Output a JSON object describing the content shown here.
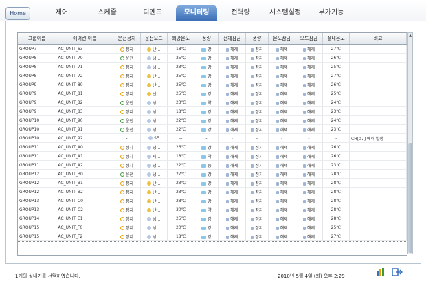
{
  "home_label": "Home",
  "tabs": [
    {
      "label": "제어"
    },
    {
      "label": "스케줄"
    },
    {
      "label": "디멘드"
    },
    {
      "label": "모니터링",
      "active": true
    },
    {
      "label": "전력량"
    },
    {
      "label": "시스템설정"
    },
    {
      "label": "부가기능"
    }
  ],
  "columns": [
    "그룹이름",
    "에어컨 이름",
    "운전정지",
    "운전모드",
    "희망온도",
    "풍량",
    "전체잠금",
    "풍량",
    "온도잠금",
    "모드잠금",
    "실내온도",
    "비고"
  ],
  "rows": [
    {
      "group": "GROUP7",
      "unit": "AC_UNIT_63",
      "op": "정지",
      "mode": "난...",
      "temp": "18℃",
      "fan": "강",
      "lock_all": "해제",
      "lock_fan": "정지",
      "lock_temp": "해제",
      "lock_mode": "해제",
      "room": "27℃",
      "note": ""
    },
    {
      "group": "GROUP8",
      "unit": "AC_UNIT_70",
      "op": "운전",
      "mode": "냉...",
      "temp": "25℃",
      "fan": "강",
      "lock_all": "해제",
      "lock_fan": "정지",
      "lock_temp": "해제",
      "lock_mode": "해제",
      "room": "26℃",
      "note": ""
    },
    {
      "group": "GROUP8",
      "unit": "AC_UNIT_71",
      "op": "정지",
      "mode": "냉...",
      "temp": "23℃",
      "fan": "강",
      "lock_all": "해제",
      "lock_fan": "정지",
      "lock_temp": "해제",
      "lock_mode": "해제",
      "room": "25℃",
      "note": ""
    },
    {
      "group": "GROUP8",
      "unit": "AC_UNIT_72",
      "op": "정지",
      "mode": "난...",
      "temp": "25℃",
      "fan": "강",
      "lock_all": "해제",
      "lock_fan": "정지",
      "lock_temp": "해제",
      "lock_mode": "해제",
      "room": "27℃",
      "note": ""
    },
    {
      "group": "GROUP9",
      "unit": "AC_UNIT_80",
      "op": "정지",
      "mode": "난...",
      "temp": "25℃",
      "fan": "강",
      "lock_all": "해제",
      "lock_fan": "정지",
      "lock_temp": "해제",
      "lock_mode": "해제",
      "room": "26℃",
      "note": ""
    },
    {
      "group": "GROUP9",
      "unit": "AC_UNIT_81",
      "op": "정지",
      "mode": "난...",
      "temp": "25℃",
      "fan": "강",
      "lock_all": "해제",
      "lock_fan": "정지",
      "lock_temp": "해제",
      "lock_mode": "해제",
      "room": "25℃",
      "note": ""
    },
    {
      "group": "GROUP9",
      "unit": "AC_UNIT_82",
      "op": "운전",
      "mode": "냉...",
      "temp": "23℃",
      "fan": "약",
      "lock_all": "해제",
      "lock_fan": "정지",
      "lock_temp": "해제",
      "lock_mode": "해제",
      "room": "24℃",
      "note": ""
    },
    {
      "group": "GROUP9",
      "unit": "AC_UNIT_83",
      "op": "정지",
      "mode": "냉...",
      "temp": "18℃",
      "fan": "강",
      "lock_all": "해제",
      "lock_fan": "정지",
      "lock_temp": "해제",
      "lock_mode": "해제",
      "room": "23℃",
      "note": ""
    },
    {
      "group": "GROUP10",
      "unit": "AC_UNIT_90",
      "op": "운전",
      "mode": "냉...",
      "temp": "22℃",
      "fan": "강",
      "lock_all": "해제",
      "lock_fan": "정지",
      "lock_temp": "해제",
      "lock_mode": "해제",
      "room": "24℃",
      "note": ""
    },
    {
      "group": "GROUP10",
      "unit": "AC_UNIT_91",
      "op": "운전",
      "mode": "냉...",
      "temp": "22℃",
      "fan": "강",
      "lock_all": "해제",
      "lock_fan": "정지",
      "lock_temp": "해제",
      "lock_mode": "해제",
      "room": "23℃",
      "note": ""
    },
    {
      "group": "GROUP10",
      "unit": "AC_UNIT_92",
      "op": "-",
      "mode": "SE",
      "temp": "--",
      "fan": "-",
      "lock_all": "-",
      "lock_fan": "-",
      "lock_temp": "-",
      "lock_mode": "-",
      "room": "--",
      "note": "CH[07] 에러 발생"
    },
    {
      "group": "GROUP11",
      "unit": "AC_UNIT_A0",
      "op": "정지",
      "mode": "냉...",
      "temp": "26℃",
      "fan": "강",
      "lock_all": "해제",
      "lock_fan": "정지",
      "lock_temp": "해제",
      "lock_mode": "해제",
      "room": "26℃",
      "note": ""
    },
    {
      "group": "GROUP11",
      "unit": "AC_UNIT_A1",
      "op": "정지",
      "mode": "제...",
      "temp": "18℃",
      "fan": "약",
      "lock_all": "해제",
      "lock_fan": "정지",
      "lock_temp": "해제",
      "lock_mode": "해제",
      "room": "26℃",
      "note": ""
    },
    {
      "group": "GROUP11",
      "unit": "AC_UNIT_A2",
      "op": "정지",
      "mode": "냉...",
      "temp": "22℃",
      "fan": "중",
      "lock_all": "해제",
      "lock_fan": "정지",
      "lock_temp": "해제",
      "lock_mode": "해제",
      "room": "23℃",
      "note": ""
    },
    {
      "group": "GROUP12",
      "unit": "AC_UNIT_B0",
      "op": "운전",
      "mode": "냉...",
      "temp": "27℃",
      "fan": "강",
      "lock_all": "해제",
      "lock_fan": "정지",
      "lock_temp": "해제",
      "lock_mode": "해제",
      "room": "28℃",
      "note": ""
    },
    {
      "group": "GROUP12",
      "unit": "AC_UNIT_B1",
      "op": "정지",
      "mode": "난...",
      "temp": "23℃",
      "fan": "강",
      "lock_all": "해제",
      "lock_fan": "정지",
      "lock_temp": "해제",
      "lock_mode": "해제",
      "room": "28℃",
      "note": ""
    },
    {
      "group": "GROUP12",
      "unit": "AC_UNIT_B2",
      "op": "정지",
      "mode": "난...",
      "temp": "23℃",
      "fan": "강",
      "lock_all": "해제",
      "lock_fan": "정지",
      "lock_temp": "해제",
      "lock_mode": "해제",
      "room": "28℃",
      "note": ""
    },
    {
      "group": "GROUP13",
      "unit": "AC_UNIT_C0",
      "op": "정지",
      "mode": "난...",
      "temp": "28℃",
      "fan": "강",
      "lock_all": "해제",
      "lock_fan": "정지",
      "lock_temp": "해제",
      "lock_mode": "해제",
      "room": "28℃",
      "note": ""
    },
    {
      "group": "GROUP13",
      "unit": "AC_UNIT_C2",
      "op": "정지",
      "mode": "난...",
      "temp": "30℃",
      "fan": "약",
      "lock_all": "해제",
      "lock_fan": "정지",
      "lock_temp": "해제",
      "lock_mode": "해제",
      "room": "28℃",
      "note": ""
    },
    {
      "group": "GROUP14",
      "unit": "AC_UNIT_E1",
      "op": "정지",
      "mode": "냉...",
      "temp": "25℃",
      "fan": "강",
      "lock_all": "해제",
      "lock_fan": "정지",
      "lock_temp": "해제",
      "lock_mode": "해제",
      "room": "28℃",
      "note": ""
    },
    {
      "group": "GROUP15",
      "unit": "AC_UNIT_F0",
      "op": "정지",
      "mode": "냉...",
      "temp": "20℃",
      "fan": "강",
      "lock_all": "해제",
      "lock_fan": "정지",
      "lock_temp": "해제",
      "lock_mode": "해제",
      "room": "25℃",
      "note": ""
    },
    {
      "group": "GROUP15",
      "unit": "AC_UNIT_F2",
      "op": "정지",
      "mode": "냉...",
      "temp": "18℃",
      "fan": "강",
      "lock_all": "해제",
      "lock_fan": "정지",
      "lock_temp": "해제",
      "lock_mode": "해제",
      "room": "27℃",
      "note": ""
    }
  ],
  "status_text": "1개의 실내기를 선택하였습니다.",
  "datetime": "2010년 5월 4일 (화) 오후 2:29",
  "colors": {
    "accent": "#3b6fb5",
    "running": "#3a9a3a",
    "stopped": "#e8a000",
    "fan": "#8cc6e8"
  },
  "icons": {
    "op_running": "ring-green-icon",
    "op_stopped": "ring-orange-icon",
    "mode_cool": "snowflake-icon",
    "mode_heat": "sun-icon",
    "fan": "wind-icon",
    "lock": "lock-icon",
    "bar_chart": "bar-chart-icon",
    "exit": "exit-icon"
  }
}
